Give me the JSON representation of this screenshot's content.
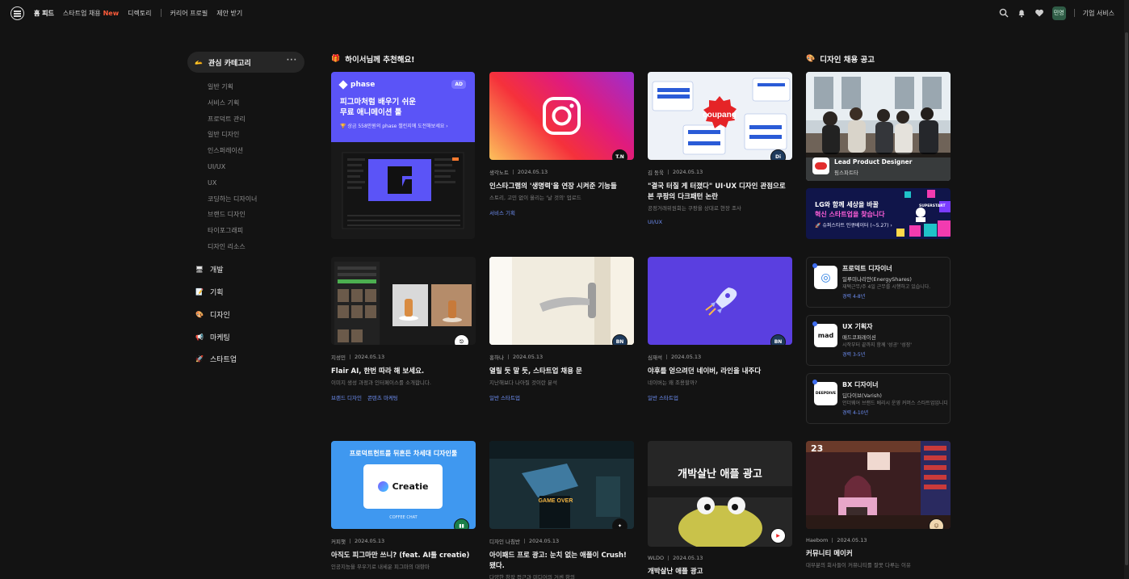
{
  "nav": {
    "home": "홈 피드",
    "startup_jobs": "스타트업 채용",
    "new_badge": "New",
    "directory": "디렉토리",
    "career_profile": "커리어 프로필",
    "offers": "제안 받기",
    "avatar": "민영",
    "company_service": "기업 서비스"
  },
  "sidebar": {
    "header": "관심 카테고리",
    "more": "···",
    "subs": [
      "일반 기획",
      "서비스 기획",
      "프로덕트 관리",
      "일반 디자인",
      "인스퍼레이션",
      "UI/UX",
      "UX",
      "코딩하는 디자이너",
      "브랜드 디자인",
      "타이포그래피",
      "디자인 리소스"
    ],
    "categories": [
      {
        "label": "개발",
        "icon": "monitor-icon"
      },
      {
        "label": "기획",
        "icon": "memo-icon"
      },
      {
        "label": "디자인",
        "icon": "palette-icon"
      },
      {
        "label": "마케팅",
        "icon": "megaphone-icon"
      },
      {
        "label": "스타트업",
        "icon": "rocket-icon"
      }
    ]
  },
  "recommend_title": "하이서님께 추천해요!",
  "jobs_title": "디자인 채용 공고",
  "ad": {
    "brand": "phase",
    "tag": "AD",
    "headline1": "피그마처럼 배우기 쉬운",
    "headline2": "무료 애니메이션 툴",
    "sub": "🏆 상금 558만원의 phase 챌린지에 도전해보세요  ›"
  },
  "cards": [
    {
      "author": "생각노트",
      "date": "2024.05.13",
      "title": "인스타그램의 '생명력'을 연장 시켜준 기능들",
      "desc": "스토리, 고민 없이 올리는 '날 것의' 업로드",
      "tags": [
        "서비스 기획"
      ],
      "badge": "T.N"
    },
    {
      "author": "김 동욱",
      "date": "2024.05.13",
      "title": "\"결국 터질 게 터졌다\" UI·UX 디자인 관점으로 본 쿠팡의 다크패턴 논란",
      "desc": "공정거래위원회는 쿠팡을 상대로 현장 조사",
      "tags": [
        "UI/UX"
      ],
      "badge": "Di",
      "thumb_text": "coupang"
    },
    {
      "author": "지성민",
      "date": "2024.05.13",
      "title": "Flair AI, 한번 따라 해 보세요.",
      "desc": "이미지 생성 과정과 인터페이스를 소개합니다.",
      "tags": [
        "브랜드 디자인",
        "콘텐츠 마케팅"
      ],
      "badge": "⎋"
    },
    {
      "author": "홍하나",
      "date": "2024.05.13",
      "title": "열릴 듯 말 듯, 스타트업 채용 문",
      "desc": "지난해보다 나아질 것이란 분석",
      "tags": [
        "일반 스타트업"
      ],
      "badge": "BN"
    },
    {
      "author": "심재석",
      "date": "2024.05.13",
      "title": "야후를 얻으려던 네이버, 라인을 내주다",
      "desc": "네이버는 왜 조용할까?",
      "tags": [
        "일반 스타트업"
      ],
      "badge": "BN"
    },
    {
      "author": "커피챗",
      "date": "2024.05.13",
      "title": "아직도 피그마만 쓰니? (feat. AI툴 creatie)",
      "desc": "인공지능을 무우기로 내세운 피그마의 대항마",
      "tags": [],
      "badge": "▮▮",
      "thumb_head": "프로덕트헌트를 뒤흔든 차세대 디자인툴",
      "thumb_logo": "Creatie",
      "thumb_foot": "COFFEE CHAT"
    },
    {
      "author": "디자인 나침반",
      "date": "2024.05.13",
      "title": "아이패드 프로 광고: 눈치 없는 애플이 Crush! 됐다.",
      "desc": "다양한 창작 접근과 미디어의 거센 항의",
      "tags": [],
      "badge": "✦",
      "thumb_text": "GAME OVER"
    },
    {
      "author": "WLDO",
      "date": "2024.05.13",
      "title": "개박살난 애플 광고",
      "desc": "",
      "tags": [],
      "badge": "▶",
      "thumb_text": "개박살난 애플 광고"
    },
    {
      "author": "Haebom",
      "date": "2024.05.13",
      "title": "커뮤니티 메이커",
      "desc": "대부분의 회사들이 커뮤니티를 잘못 다루는 이유",
      "tags": [],
      "badge": "☺",
      "thumb_text": "23"
    }
  ],
  "hire": {
    "title": "Lead Product Designer",
    "company": "핌스파트타",
    "banner_line1": "LG와 함께 세상을 바꿀",
    "banner_line2": "혁신 스타트업을 찾습니다",
    "banner_line3": "🚀 슈퍼스타트 인큐베이터 (~5.27)  ›",
    "banner_brand": "SUPERSTART"
  },
  "jobs": [
    {
      "title": "프로덕트 디자이너",
      "company": "일루미나리안(EnergyShares)",
      "desc": "재택근무/주 4일 근무를 시행하고 있습니다.",
      "exp": "경력 4-8년",
      "logo": "◎"
    },
    {
      "title": "UX 기획자",
      "company": "매드코퍼레이션",
      "desc": "시작부터 끝까지 함께 '성공' '성장'",
      "exp": "경력 3-5년",
      "logo": "mad"
    },
    {
      "title": "BX 디자이너",
      "company": "딥다이브(Varish)",
      "desc": "언더웨어 브랜드 베리시 운영 커머스 스타트업입니다",
      "exp": "경력 4-10년",
      "logo": "DEEPDIVE"
    }
  ],
  "colors": {
    "accent_blue": "#6e8ff5",
    "new_red": "#ff5b3a",
    "phase_purple": "#5b54f7"
  }
}
